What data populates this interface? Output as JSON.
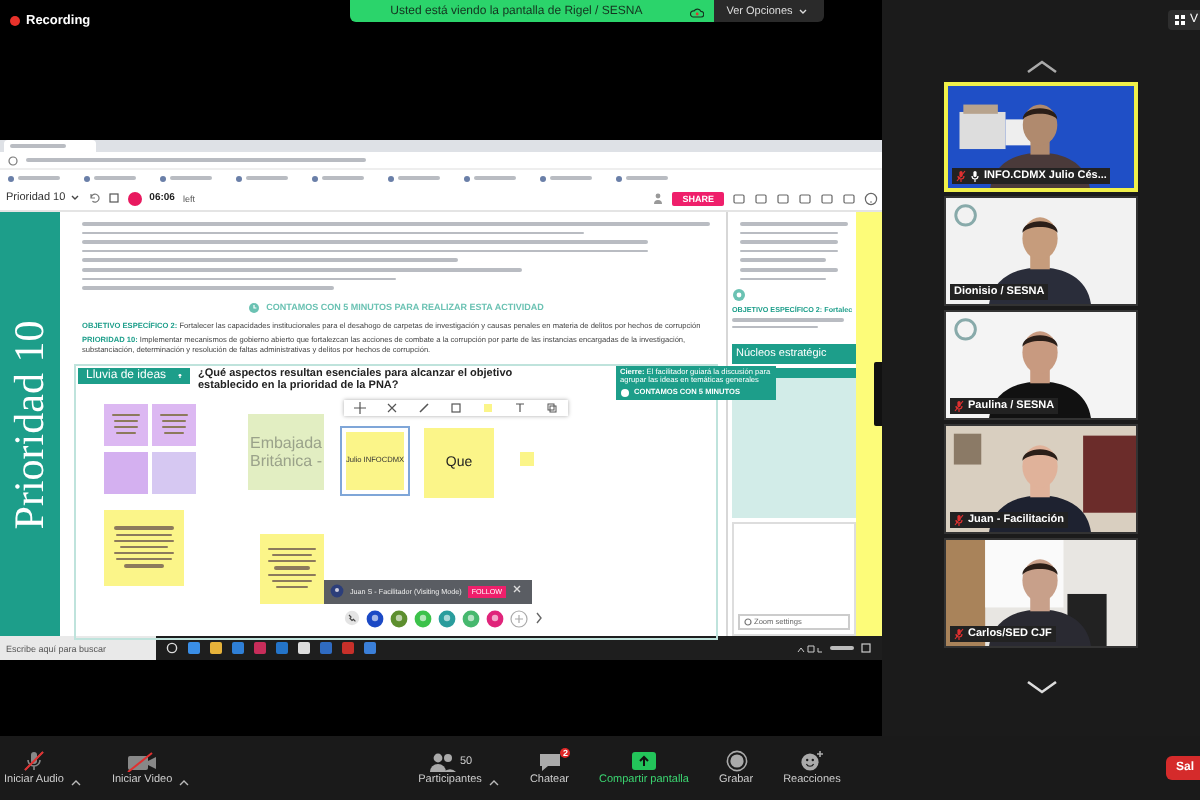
{
  "recording": {
    "label": "Recording"
  },
  "share_banner": {
    "text": "Usted está viendo la pantalla de Rigel / SESNA",
    "options": "Ver Opciones"
  },
  "view_button": {
    "label": "V"
  },
  "shared_screen": {
    "mural_toolbar": {
      "board": "Prioridad 10",
      "timer": "06:06",
      "timer_suffix": "left",
      "share": "SHARE"
    },
    "side_title": "Prioridad 10",
    "time_note": "CONTAMOS CON 5 MINUTOS PARA REALIZAR ESTA ACTIVIDAD",
    "objectives": [
      {
        "label": "OBJETIVO ESPECÍFICO 2:",
        "text": "Fortalecer las capacidades institucionales para el desahogo de carpetas de investigación y causas penales en materia de delitos por hechos de corrupción"
      },
      {
        "label": "PRIORIDAD 10:",
        "text": "Implementar mecanismos de gobierno abierto que fortalezcan las acciones de combate a la corrupción por parte de las instancias encargadas de la investigación, substanciación, determinación y resolución de faltas administrativas y delitos por hechos de corrupción."
      }
    ],
    "board": {
      "title": "Lluvia de ideas",
      "question": "¿Qué aspectos resultan esenciales para alcanzar el objetivo establecido en la prioridad de la PNA?",
      "closing": "**Cierre:** El facilitador guiará la discusión para agrupar las ideas en temáticas generales",
      "closing_time": "CONTAMOS CON 5 MINUTOS",
      "stickies": [
        {
          "kind": "scribble",
          "color": "#dcb8f2",
          "selected": false
        },
        {
          "kind": "scribble",
          "color": "#dcb8f2",
          "selected": false
        },
        {
          "kind": "blank",
          "color": "#d4b0f0",
          "selected": false
        },
        {
          "kind": "blank",
          "color": "#d6c8f2",
          "selected": false
        },
        {
          "kind": "scribble",
          "color": "#fbf589",
          "selected": false
        },
        {
          "kind": "note",
          "color": "#e2eec2",
          "text": "Embajada Británica -",
          "selected": false
        },
        {
          "kind": "note",
          "color": "#fbf589",
          "text": "Julio INFOCDMX",
          "selected": true
        },
        {
          "kind": "note",
          "color": "#fbf589",
          "text": "Que",
          "selected": false
        },
        {
          "kind": "blank",
          "color": "#fbf589",
          "selected": false
        },
        {
          "kind": "scribble",
          "color": "#fbf589",
          "selected": false
        }
      ],
      "visitor": {
        "text": "Juan S - Facilitador (Visiting Mode)",
        "follow": "FOLLOW"
      }
    },
    "side_doc": {
      "objective": "OBJETIVO ESPECÍFICO 2: Fortalec",
      "section": "Núcleos estratégic",
      "settings": "Zoom settings"
    },
    "taskbar": {
      "search_placeholder": "Escribe aquí para buscar"
    }
  },
  "participants": [
    {
      "name": "INFO.CDMX Julio Cés...",
      "muted": true,
      "speaking": true
    },
    {
      "name": "Dionisio / SESNA",
      "muted": false,
      "speaking": false
    },
    {
      "name": "Paulina / SESNA",
      "muted": true,
      "speaking": false
    },
    {
      "name": "Juan - Facilitación",
      "muted": true,
      "speaking": false
    },
    {
      "name": "Carlos/SED CJF",
      "muted": true,
      "speaking": false
    }
  ],
  "toolbar": {
    "items": [
      {
        "kind": "audio",
        "label": "Iniciar Audio"
      },
      {
        "kind": "video",
        "label": "Iniciar Video"
      },
      {
        "kind": "participants",
        "label": "Participantes",
        "count": "50"
      },
      {
        "kind": "chat",
        "label": "Chatear",
        "badge": "2"
      },
      {
        "kind": "share",
        "label": "Compartir pantalla"
      },
      {
        "kind": "record",
        "label": "Grabar"
      },
      {
        "kind": "reactions",
        "label": "Reacciones"
      }
    ],
    "leave": "Sal"
  }
}
